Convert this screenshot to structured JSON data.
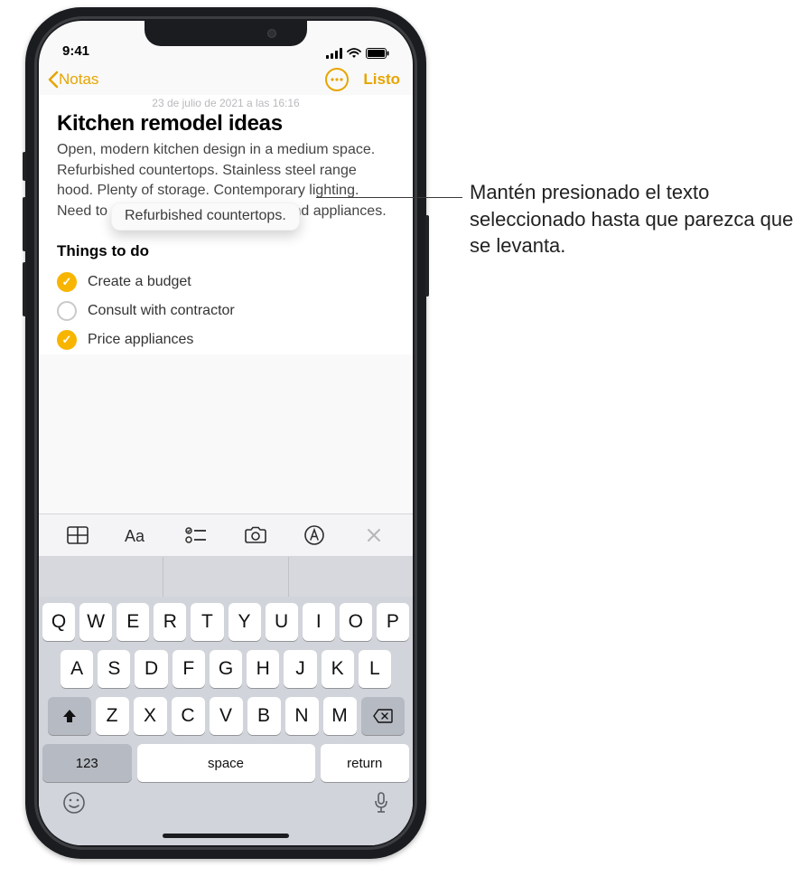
{
  "status": {
    "time": "9:41"
  },
  "nav": {
    "back_label": "Notas",
    "done_label": "Listo"
  },
  "note": {
    "date_line": "23 de julio de 2021 a las 16:16",
    "title": "Kitchen remodel ideas",
    "body": "Open, modern kitchen design in a medium space. Refurbished countertops. Stainless steel range hood. Plenty of storage. Contemporary lighting. Need to research colors, materials, and appliances.",
    "floating_selection": "Refurbished countertops.",
    "subheading": "Things to do",
    "checklist": [
      {
        "label": "Create a budget",
        "done": true
      },
      {
        "label": "Consult with contractor",
        "done": false
      },
      {
        "label": "Price appliances",
        "done": true
      }
    ]
  },
  "keyboard": {
    "row1": [
      "Q",
      "W",
      "E",
      "R",
      "T",
      "Y",
      "U",
      "I",
      "O",
      "P"
    ],
    "row2": [
      "A",
      "S",
      "D",
      "F",
      "G",
      "H",
      "J",
      "K",
      "L"
    ],
    "row3": [
      "Z",
      "X",
      "C",
      "V",
      "B",
      "N",
      "M"
    ],
    "numbers_label": "123",
    "space_label": "space",
    "return_label": "return"
  },
  "callout": "Mantén presionado el texto seleccionado hasta que parezca que se levanta."
}
